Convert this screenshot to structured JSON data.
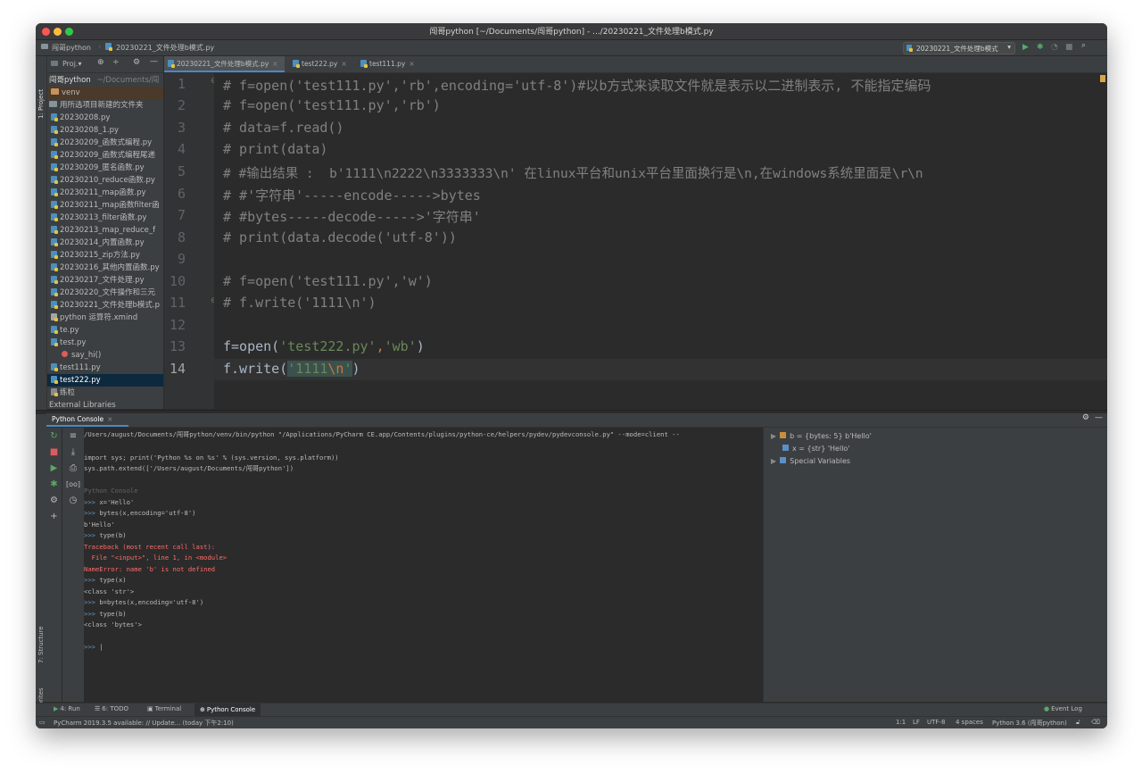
{
  "window": {
    "title": "闯哥python [~/Documents/闯哥python] - .../20230221_文件处理b模式.py",
    "colors": {
      "close": "#fc5753",
      "minimize": "#fdbc40",
      "maximize": "#33c748"
    }
  },
  "navbar": {
    "project": "闯哥python",
    "file": "20230221_文件处理b模式.py",
    "run_config": "20230221_文件处理b模式",
    "icons": [
      "run-icon",
      "debug-icon",
      "coverage-icon",
      "stop-icon",
      "search-icon"
    ]
  },
  "sidebar": {
    "project_tab": "1: Project",
    "structure_tab": "7: Structure",
    "favorites_tab": "2: Favorites"
  },
  "project_panel": {
    "header": "Proj.▾",
    "items": [
      {
        "label": "闯哥python",
        "extra": "~/Documents/闯",
        "type": "root"
      },
      {
        "label": "venv",
        "type": "folder-orange"
      },
      {
        "label": "用所选项目新建的文件夹",
        "type": "folder"
      },
      {
        "label": "20230208.py",
        "type": "file"
      },
      {
        "label": "20230208_1.py",
        "type": "file"
      },
      {
        "label": "20230209_函数式编程.py",
        "type": "file"
      },
      {
        "label": "20230209_函数式编程尾递",
        "type": "file"
      },
      {
        "label": "20230209_匿名函数.py",
        "type": "file"
      },
      {
        "label": "20230210_reduce函数.py",
        "type": "file"
      },
      {
        "label": "20230211_map函数.py",
        "type": "file"
      },
      {
        "label": "20230211_map函数filter函",
        "type": "file"
      },
      {
        "label": "20230213_filter函数.py",
        "type": "file"
      },
      {
        "label": "20230213_map_reduce_f",
        "type": "file"
      },
      {
        "label": "20230214_内置函数.py",
        "type": "file"
      },
      {
        "label": "20230215_zip方法.py",
        "type": "file"
      },
      {
        "label": "20230216_其他内置函数.py",
        "type": "file"
      },
      {
        "label": "20230217_文件处理.py",
        "type": "file"
      },
      {
        "label": "20230220_文件操作和三元",
        "type": "file"
      },
      {
        "label": "20230221_文件处理b模式.p",
        "type": "file"
      },
      {
        "label": "python 运算符.xmind",
        "type": "file"
      },
      {
        "label": "te.py",
        "type": "file"
      },
      {
        "label": "test.py",
        "type": "file"
      },
      {
        "label": "say_hi()",
        "type": "func"
      },
      {
        "label": "test111.py",
        "type": "file"
      },
      {
        "label": "test222.py",
        "type": "file",
        "selected": true
      },
      {
        "label": "练粒",
        "type": "file"
      },
      {
        "label": "External Libraries",
        "type": "lib"
      }
    ]
  },
  "editor_tabs": [
    {
      "label": "20230221_文件处理b模式.py",
      "active": true
    },
    {
      "label": "test222.py",
      "active": false
    },
    {
      "label": "test111.py",
      "active": false
    }
  ],
  "code": {
    "line_numbers": [
      "1",
      "2",
      "3",
      "4",
      "5",
      "6",
      "7",
      "8",
      "9",
      "10",
      "11",
      "12",
      "13",
      "14"
    ],
    "lines": {
      "l1": "# f=open('test111.py','rb',encoding='utf-8')#以b方式来读取文件就是表示以二进制表示, 不能指定编码",
      "l2": "# f=open('test111.py','rb')",
      "l3": "# data=f.read()",
      "l4": "# print(data)",
      "l5": "# #输出结果 :  b'1111\\n2222\\n3333333\\n' 在linux平台和unix平台里面换行是\\n,在windows系统里面是\\r\\n",
      "l6": "# #'字符串'-----encode----->bytes",
      "l7": "# #bytes-----decode----->'字符串'",
      "l8": "# print(data.decode('utf-8'))",
      "l10": "# f=open('test111.py','w')",
      "l11": "# f.write('1111\\n')",
      "l13a": "f=open(",
      "l13b": "'test222.py'",
      "l13c": ",",
      "l13d": "'wb'",
      "l13e": ")",
      "l14a": "f.write(",
      "l14b": "'1111",
      "l14c": "\\n",
      "l14d": "'",
      "l14e": ")"
    }
  },
  "console": {
    "tab": "Python Console",
    "lines": {
      "c1": "/Users/august/Documents/闯哥python/venv/bin/python \"/Applications/PyCharm CE.app/Contents/plugins/python-ce/helpers/pydev/pydevconsole.py\" --mode=client --",
      "c2": "import sys; print('Python %s on %s' % (sys.version, sys.platform))",
      "c3": "sys.path.extend(['/Users/august/Documents/闯哥python'])",
      "c4": "Python Console",
      "c5p": ">>> ",
      "c5": "x='Hello'",
      "c6p": ">>> ",
      "c6": "bytes(x,encoding='utf-8')",
      "c7": "b'Hello'",
      "c8p": ">>> ",
      "c8": "type(b)",
      "c9": "Traceback (most recent call last):",
      "c10": "  File \"<input>\", line 1, in <module>",
      "c11": "NameError: name 'b' is not defined",
      "c12p": ">>> ",
      "c12": "type(x)",
      "c13": "<class 'str'>",
      "c14p": ">>> ",
      "c14": "b=bytes(x,encoding='utf-8')",
      "c15p": ">>> ",
      "c15": "type(b)",
      "c16": "<class 'bytes'>",
      "c17p": ">>> ",
      "c17": "|"
    }
  },
  "variables": {
    "v1": "b = {bytes: 5} b'Hello'",
    "v2": "x = {str} 'Hello'",
    "v3": "Special Variables"
  },
  "bottom_tabs": {
    "run": "4: Run",
    "todo": "6: TODO",
    "terminal": "Terminal",
    "python_console": "Python Console",
    "event_log": "Event Log"
  },
  "status": {
    "message": "PyCharm 2019.3.5 available: // Update... (today 下午2:10)",
    "position": "1:1",
    "line_sep": "LF",
    "encoding": "UTF-8",
    "indent": "4 spaces",
    "interpreter": "Python 3.6 (闯哥python)"
  }
}
